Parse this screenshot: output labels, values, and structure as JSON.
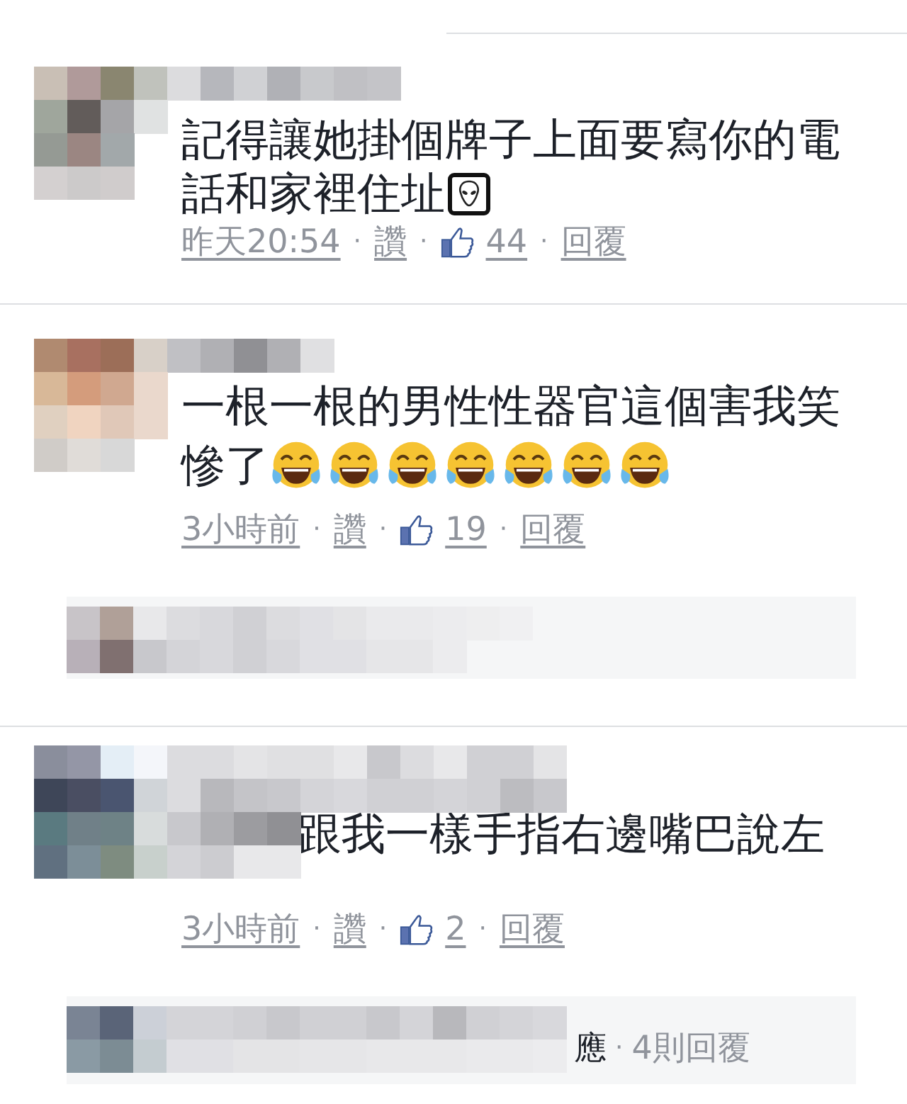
{
  "comments": [
    {
      "lines": [
        "記得讓她掛個牌子上面要寫你的電",
        "話和家裡住址"
      ],
      "emoji": [
        {
          "kind": "alien"
        }
      ],
      "meta": [
        {
          "kind": "link",
          "text": "昨天20:54"
        },
        {
          "kind": "sep",
          "text": "·"
        },
        {
          "kind": "link",
          "text": "讚"
        },
        {
          "kind": "sep",
          "text": "·"
        },
        {
          "kind": "likes",
          "text": "44"
        },
        {
          "kind": "sep",
          "text": "·"
        },
        {
          "kind": "link",
          "text": "回覆"
        }
      ]
    },
    {
      "lines": [
        "一根一根的男性性器官這個害我笑",
        "慘了"
      ],
      "emoji": [
        {
          "kind": "laugh"
        },
        {
          "kind": "laugh"
        },
        {
          "kind": "laugh"
        },
        {
          "kind": "laugh"
        },
        {
          "kind": "laugh"
        },
        {
          "kind": "laugh"
        },
        {
          "kind": "laugh"
        }
      ],
      "meta": [
        {
          "kind": "link",
          "text": "3小時前"
        },
        {
          "kind": "sep",
          "text": "·"
        },
        {
          "kind": "link",
          "text": "讚"
        },
        {
          "kind": "sep",
          "text": "·"
        },
        {
          "kind": "likes",
          "text": "19"
        },
        {
          "kind": "sep",
          "text": "·"
        },
        {
          "kind": "link",
          "text": "回覆"
        }
      ],
      "reply_preview": {
        "kind": "redacted"
      }
    },
    {
      "lines": [
        "跟我一樣手指右邊嘴巴說左"
      ],
      "meta": [
        {
          "kind": "link",
          "text": "3小時前"
        },
        {
          "kind": "sep",
          "text": "·"
        },
        {
          "kind": "link",
          "text": "讚"
        },
        {
          "kind": "sep",
          "text": "·"
        },
        {
          "kind": "likes",
          "text": "2"
        },
        {
          "kind": "sep",
          "text": "·"
        },
        {
          "kind": "link",
          "text": "回覆"
        }
      ],
      "reply_preview": {
        "kind": "snippet",
        "text": "應",
        "separator": "·",
        "replies": "4則回覆"
      }
    }
  ]
}
